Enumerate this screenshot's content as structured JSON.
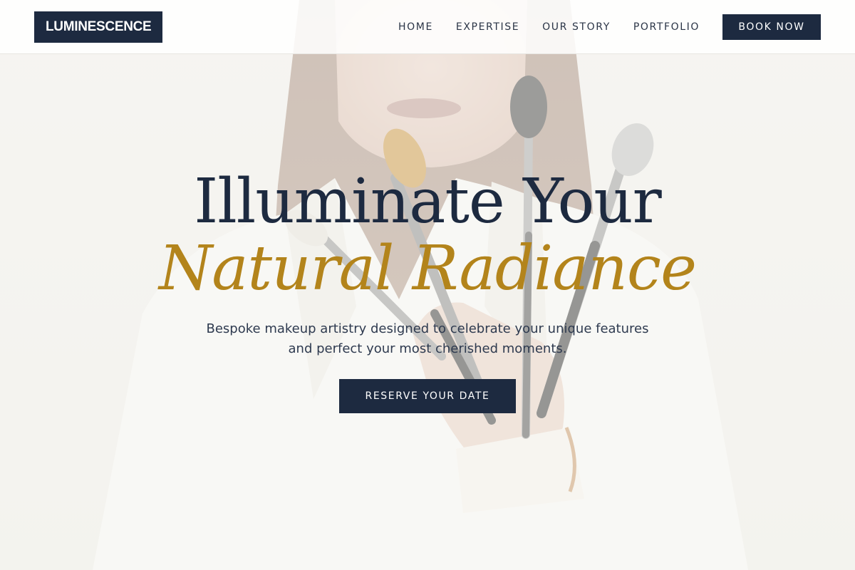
{
  "header": {
    "logo": "LUMINESCENCE",
    "nav": [
      {
        "label": "HOME"
      },
      {
        "label": "EXPERTISE"
      },
      {
        "label": "OUR STORY"
      },
      {
        "label": "PORTFOLIO"
      }
    ],
    "cta": "BOOK NOW"
  },
  "hero": {
    "headline_line1": "Illuminate Your",
    "headline_line2": "Natural Radiance",
    "subtitle": "Bespoke makeup artistry designed to celebrate your unique features and perfect your most cherished moments.",
    "cta": "RESERVE YOUR DATE",
    "background_image": "woman-holding-makeup-brushes-photo"
  },
  "colors": {
    "navy": "#1d2a40",
    "gold": "#b3841b",
    "text": "#2e3a4f",
    "header_bg": "#ffffff"
  }
}
